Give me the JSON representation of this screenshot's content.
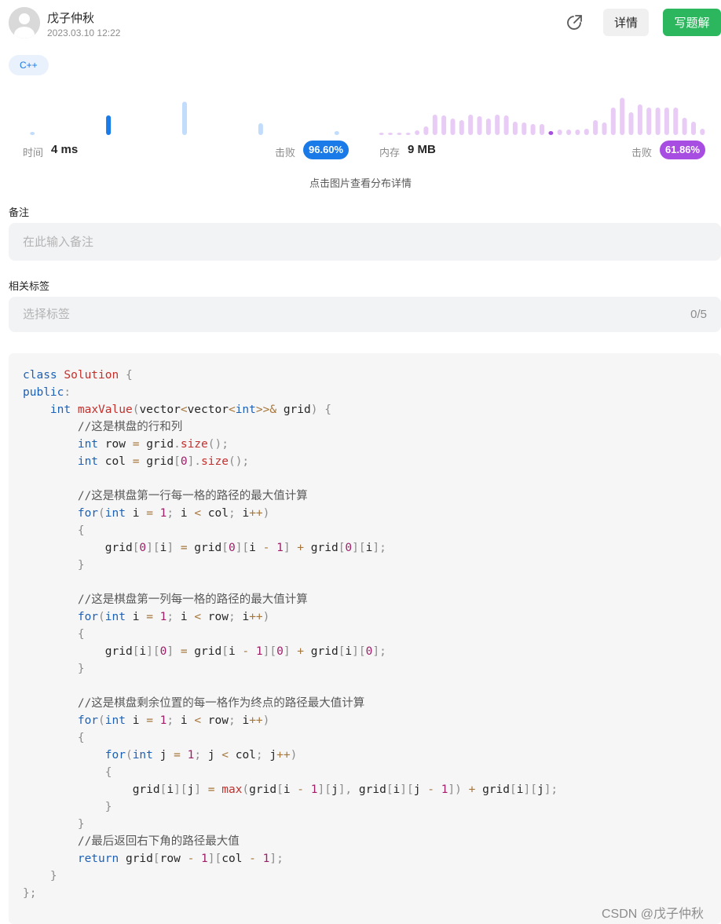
{
  "header": {
    "author": "戊子仲秋",
    "date": "2023.03.10 12:22",
    "detail_label": "详情",
    "write_label": "写题解"
  },
  "language_tag": "C++",
  "performance": {
    "time_label": "时间",
    "time_value": "4 ms",
    "time_beat_label": "击败",
    "time_beat_value": "96.60%",
    "time_color": "#1a7ae8",
    "time_bar_light": "#c2ddfb",
    "time_bars": [
      0.08,
      0,
      0,
      0.5,
      0,
      0,
      0.85,
      0,
      0,
      0.3,
      0,
      0,
      0.1
    ],
    "time_selected_index": 3,
    "memory_label": "内存",
    "memory_value": "9 MB",
    "memory_beat_label": "击败",
    "memory_beat_value": "61.86%",
    "memory_color": "#a84de2",
    "memory_bar_light": "#e8ccf6",
    "memory_bars": [
      0.04,
      0.05,
      0.05,
      0.06,
      0.12,
      0.22,
      0.52,
      0.5,
      0.42,
      0.38,
      0.52,
      0.48,
      0.42,
      0.52,
      0.5,
      0.34,
      0.32,
      0.28,
      0.28,
      0.1,
      0.14,
      0.14,
      0.14,
      0.16,
      0.38,
      0.32,
      0.7,
      0.95,
      0.58,
      0.78,
      0.7,
      0.7,
      0.7,
      0.7,
      0.44,
      0.34,
      0.16
    ],
    "memory_selected_index": 19,
    "hint": "点击图片查看分布详情"
  },
  "notes": {
    "label": "备注",
    "placeholder": "在此输入备注"
  },
  "tags": {
    "label": "相关标签",
    "placeholder": "选择标签",
    "counter": "0/5"
  },
  "watermark": "CSDN @戊子仲秋"
}
